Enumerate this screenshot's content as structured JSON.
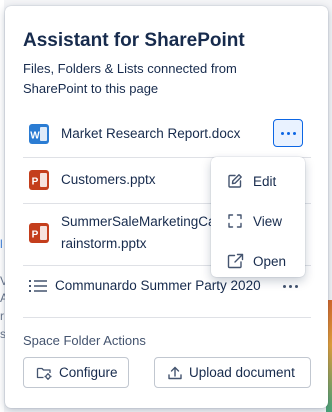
{
  "background": {
    "peek_letters": [
      "l",
      "V",
      "A",
      "r",
      "s"
    ]
  },
  "panel": {
    "title": "Assistant for SharePoint",
    "subtitle": "Files, Folders & Lists connected from SharePoint to this page"
  },
  "files": [
    {
      "name": "Market Research Report.docx",
      "icon": "word-doc-icon",
      "icon_letter": "W",
      "icon_color": "#2b7cd3"
    },
    {
      "name": "Customers.pptx",
      "icon": "powerpoint-icon",
      "icon_letter": "P",
      "icon_color": "#c43e1c"
    },
    {
      "name_line1": "SummerSaleMarketingCa",
      "name_line2": "rainstorm.pptx",
      "icon": "powerpoint-icon",
      "icon_letter": "P",
      "icon_color": "#c43e1c"
    },
    {
      "name": "Communardo Summer Party 2020",
      "icon": "list-icon"
    }
  ],
  "menu": {
    "items": [
      {
        "label": "Edit",
        "icon": "edit-icon"
      },
      {
        "label": "View",
        "icon": "view-icon"
      },
      {
        "label": "Open",
        "icon": "open-external-icon"
      }
    ]
  },
  "actions": {
    "section_label": "Space Folder Actions",
    "configure_label": "Configure",
    "upload_label": "Upload document"
  },
  "colors": {
    "accent": "#0c66e4",
    "text": "#172b4d",
    "subtle_text": "#44546f",
    "divider": "#dfe1e6"
  }
}
